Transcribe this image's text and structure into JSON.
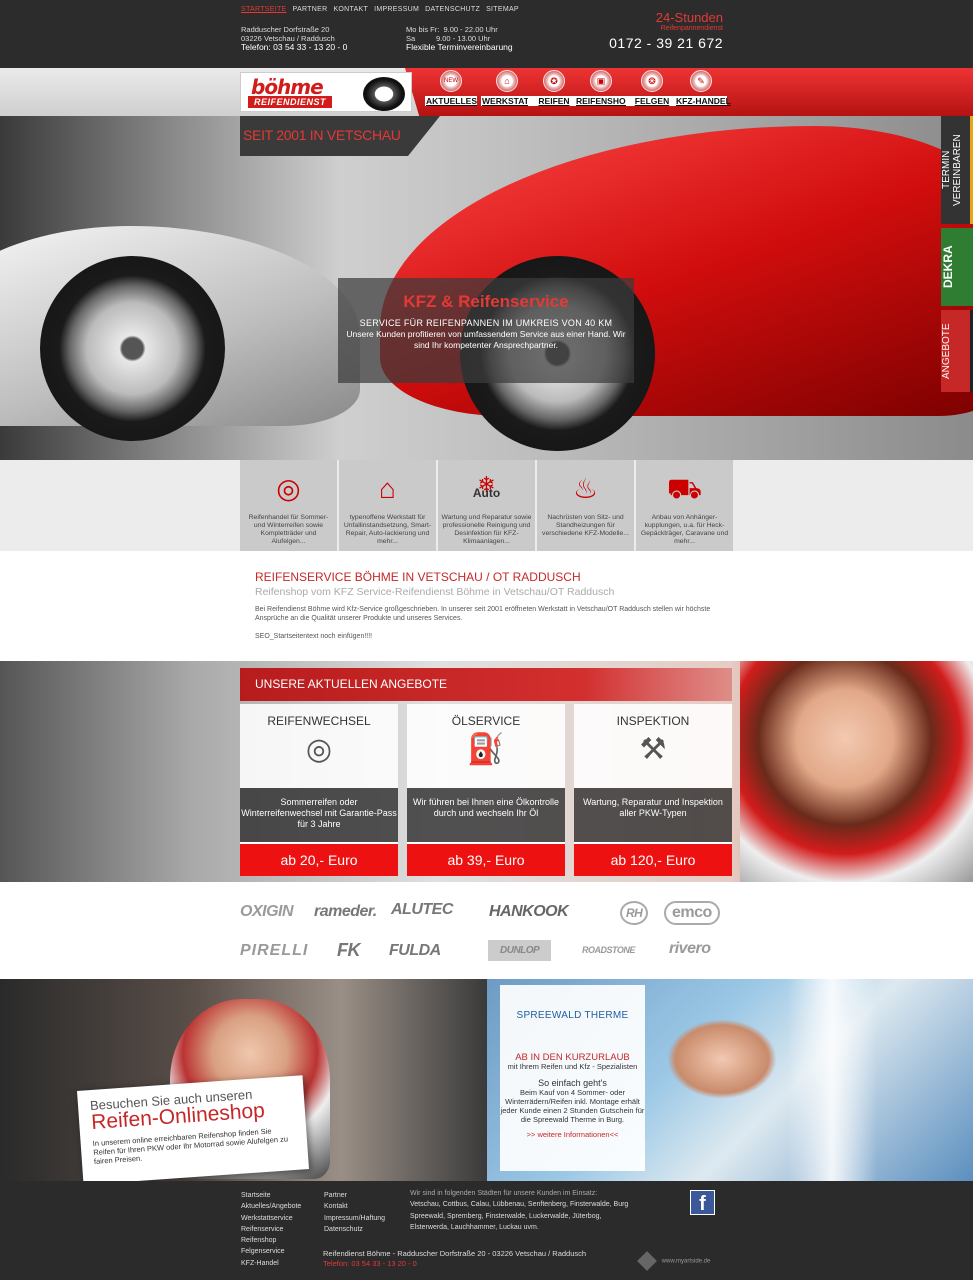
{
  "top_links": [
    "STARTSEITE",
    "PARTNER",
    "KONTAKT",
    "IMPRESSUM",
    "DATENSCHUTZ",
    "SITEMAP"
  ],
  "address": {
    "line1": "Radduscher Dorfstraße 20",
    "line2": "03226 Vetschau / Raddusch",
    "phone": "Telefon: 03 54 33 - 13 20 - 0"
  },
  "hours": {
    "line1": "Mo bis Fr:  9.00 - 22.00 Uhr",
    "line2": "Sa          9.00 - 13.00 Uhr",
    "line3": "Flexible Terminvereinbarung"
  },
  "hotline": {
    "title": "24-Stunden",
    "sub": "Reifenpannendienst",
    "number": "0172 - 39 21 672"
  },
  "logo": {
    "name": "böhme",
    "sub": "REIFENDIENST"
  },
  "nav": [
    {
      "label": "AKTUELLES",
      "icon": "NEW"
    },
    {
      "label": "WERKSTATT",
      "icon": "⌂"
    },
    {
      "label": "REIFEN",
      "icon": "✪"
    },
    {
      "label": "REIFENSHOP",
      "icon": "▣"
    },
    {
      "label": "FELGEN",
      "icon": "❂"
    },
    {
      "label": "KFZ-HANDEL",
      "icon": "✎"
    }
  ],
  "hero": {
    "since": "SEIT 2001 IN VETSCHAU",
    "title": "KFZ & Reifenservice",
    "subtitle": "SERVICE FÜR REIFENPANNEN IM UMKREIS VON 40 KM",
    "text": "Unsere Kunden profitieren von umfassendem Service aus einer Hand. Wir sind Ihr kompetenter Ansprechpartner."
  },
  "side_tabs": [
    "TERMIN VEREINBAREN",
    "DEKRA",
    "ANGEBOTE"
  ],
  "services": [
    {
      "icon": "◎",
      "text": "Reifenhandel für Sommer- und Winterreifen sowie Kompletträder und Alufelgen..."
    },
    {
      "icon": "⌂",
      "text": "typenoffene Werkstatt für Unfallinstandsetzung, Smart-Repair, Auto-lackierung und mehr..."
    },
    {
      "icon": "❄",
      "label": "Auto",
      "text": "Wartung und Reparatur sowie professionelle Reinigung und Desinfektion für KFZ-Klimaanlagen..."
    },
    {
      "icon": "♨",
      "text": "Nachrüsten von Sitz- und Standheizungen für verschiedene KFZ-Modelle..."
    },
    {
      "icon": "⛟",
      "text": "Anbau von Anhänger-kupplungen, u.a. für Heck-Gepäckträger, Caravane und mehr..."
    }
  ],
  "intro": {
    "title": "REIFENSERVICE BÖHME IN VETSCHAU / OT RADDUSCH",
    "subtitle": "Reifenshop vom KFZ Service-Reifendienst Böhme in Vetschau/OT Raddusch",
    "text": "Bei Reifendienst Böhme wird Kfz-Service großgeschrieben. In unserer seit 2001 eröffneten Werkstatt in Vetschau/OT Raddusch stellen wir höchste Ansprüche an die Qualität unserer Produkte und unseres Services.",
    "seo": "SEO_Startseitentext noch einfügen!!!!"
  },
  "offers": {
    "heading": "UNSERE AKTUELLEN ANGEBOTE",
    "items": [
      {
        "title": "REIFENWECHSEL",
        "icon": "◎",
        "text": "Sommerreifen oder Winterreifenwechsel mit Garantie-Pass für 3 Jahre",
        "price": "ab 20,- Euro"
      },
      {
        "title": "ÖLSERVICE",
        "icon": "⛽",
        "text": "Wir führen bei Ihnen eine Ölkontrolle durch und wechseln Ihr Öl",
        "price": "ab 39,- Euro"
      },
      {
        "title": "INSPEKTION",
        "icon": "⚒",
        "text": "Wartung, Reparatur und Inspektion aller PKW-Typen",
        "price": "ab 120,- Euro"
      }
    ]
  },
  "brands_row1": [
    "OXIGIN",
    "rameder.",
    "ALUTEC",
    "HANKOOK",
    "RH",
    "emco"
  ],
  "brands_row2": [
    "PIRELLI",
    "FK",
    "FULDA",
    "DUNLOP",
    "ROADSTONE",
    "rivero"
  ],
  "shop_promo": {
    "line1": "Besuchen Sie auch unseren",
    "line2": "Reifen-Onlineshop",
    "text": "In unserem online erreichbaren Reifenshop finden Sie Reifen für Ihren PKW oder Ihr Motorrad sowie Alufelgen zu fairen Preisen."
  },
  "spreewald": {
    "logo": "SPREEWALD THERME",
    "heading": "AB IN DEN KURZURLAUB",
    "sub": "mit Ihrem Reifen und Kfz - Spezialisten",
    "h2": "So einfach geht's",
    "text": "Beim Kauf von 4 Sommer- oder Winterrädern/Reifen inkl. Montage erhält jeder Kunde einen 2 Stunden Gutschein für die Spreewald Therme in Burg.",
    "link": ">> weitere Informationen<<"
  },
  "footer": {
    "col1": [
      "Startseite",
      "Aktuelles/Angebote",
      "Werkstattservice",
      "Reifenservice",
      "Reifenshop",
      "Felgenservice",
      "KFZ-Handel"
    ],
    "col2": [
      "Partner",
      "Kontakt",
      "Impressum/Haftung",
      "Datenschutz"
    ],
    "cities_heading": "Wir sind in folgenden Städten für unsere Kunden im Einsatz:",
    "cities": "Vetschau, Cottbus, Calau, Lübbenau, Senftenberg, Finsterwalde, Burg Spreewald, Spremberg, Finsterwalde, Luckerwalde, Jüterbog, Elsterwerda, Lauchhammer, Luckau uvm.",
    "address": "Reifendienst Böhme  -  Radduscher Dorfstraße 20  -  03226 Vetschau / Raddusch",
    "phone": "Telefon: 03 54 33 - 13 20 - 0",
    "credit": "www.myartside.de",
    "fb": "f"
  },
  "colors": {
    "accent": "#d21c1c",
    "dark": "#2c2c2c"
  }
}
